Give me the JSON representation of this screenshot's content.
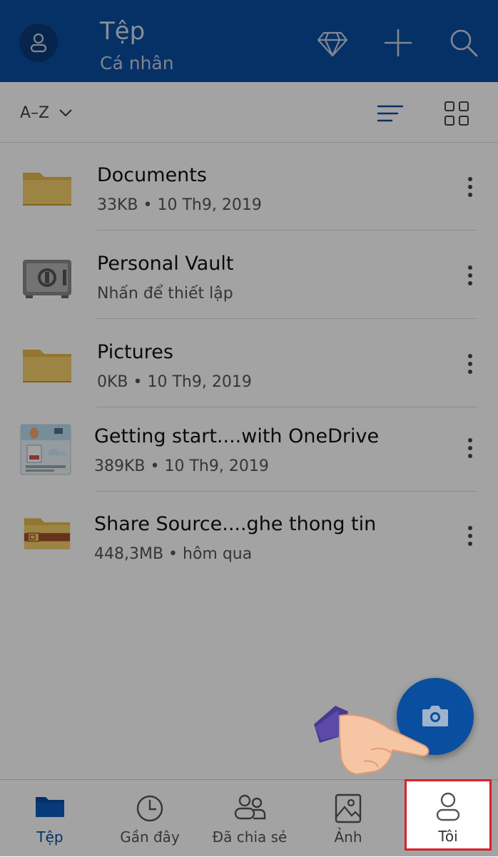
{
  "header": {
    "title": "Tệp",
    "subtitle": "Cá nhân",
    "actions": [
      "premium-diamond-icon",
      "add-icon",
      "search-icon"
    ]
  },
  "sortbar": {
    "sort_label": "A–Z"
  },
  "files": [
    {
      "name": "Documents",
      "meta": "33KB • 10 Th9, 2019",
      "icon": "folder-icon"
    },
    {
      "name": "Personal Vault",
      "meta": "Nhấn để thiết lập",
      "icon": "vault-icon"
    },
    {
      "name": "Pictures",
      "meta": "0KB • 10 Th9, 2019",
      "icon": "folder-icon"
    },
    {
      "name": "Getting start....with OneDrive",
      "meta": "389KB • 10 Th9, 2019",
      "icon": "pdf-thumbnail"
    },
    {
      "name": "Share Source....ghe thong tin",
      "meta": "448,3MB • hôm qua",
      "icon": "shared-folder-icon"
    }
  ],
  "bottom_nav": [
    {
      "label": "Tệp",
      "icon": "folder-icon",
      "active": true
    },
    {
      "label": "Gần đây",
      "icon": "clock-icon",
      "active": false
    },
    {
      "label": "Đã chia sẻ",
      "icon": "people-icon",
      "active": false
    },
    {
      "label": "Ảnh",
      "icon": "image-icon",
      "active": false
    },
    {
      "label": "Tôi",
      "icon": "person-icon",
      "active": false
    }
  ],
  "colors": {
    "brand": "#0a4ea0",
    "highlight": "#d8222a"
  }
}
